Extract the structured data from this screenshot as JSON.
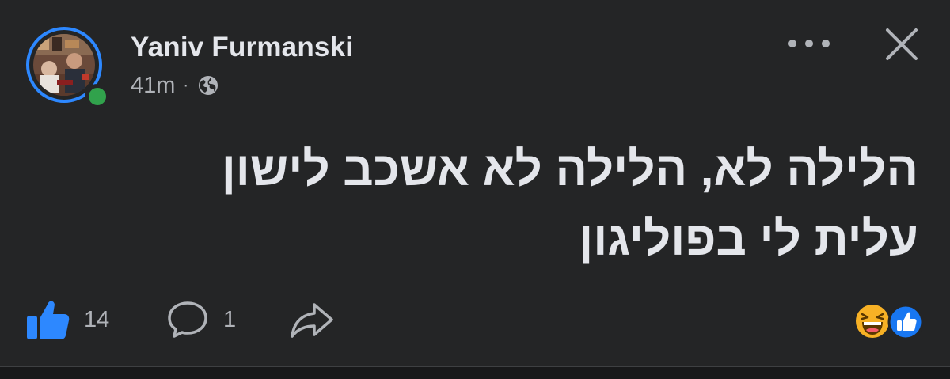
{
  "post": {
    "author": "Yaniv Furmanski",
    "time": "41m",
    "separator": "·",
    "audience_icon": "globe-icon",
    "online": true,
    "text_lines": [
      "הלילה לא, הלילה לא אשכב לישון",
      "עלית לי בפוליגון"
    ]
  },
  "footer": {
    "like_count": "14",
    "comment_count": "1",
    "share_icon": "share-icon",
    "reactions": [
      "haha-reaction-icon",
      "like-reaction-icon"
    ]
  },
  "colors": {
    "background": "#242526",
    "primary_text": "#e4e6eb",
    "secondary_text": "#b0b3b8",
    "accent_blue": "#2d88ff",
    "online_green": "#31a24c"
  }
}
